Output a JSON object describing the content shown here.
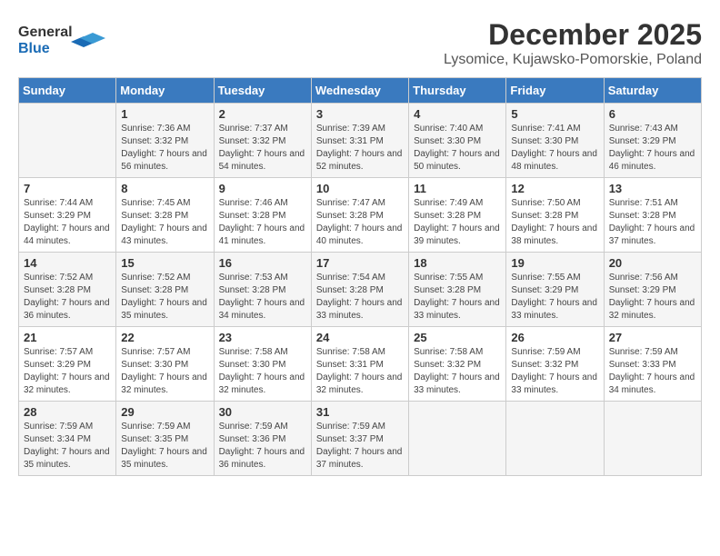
{
  "logo": {
    "line1": "General",
    "line2": "Blue"
  },
  "title": "December 2025",
  "subtitle": "Lysomice, Kujawsko-Pomorskie, Poland",
  "days_of_week": [
    "Sunday",
    "Monday",
    "Tuesday",
    "Wednesday",
    "Thursday",
    "Friday",
    "Saturday"
  ],
  "weeks": [
    [
      {
        "day": "",
        "info": ""
      },
      {
        "day": "1",
        "info": "Sunrise: 7:36 AM\nSunset: 3:32 PM\nDaylight: 7 hours\nand 56 minutes."
      },
      {
        "day": "2",
        "info": "Sunrise: 7:37 AM\nSunset: 3:32 PM\nDaylight: 7 hours\nand 54 minutes."
      },
      {
        "day": "3",
        "info": "Sunrise: 7:39 AM\nSunset: 3:31 PM\nDaylight: 7 hours\nand 52 minutes."
      },
      {
        "day": "4",
        "info": "Sunrise: 7:40 AM\nSunset: 3:30 PM\nDaylight: 7 hours\nand 50 minutes."
      },
      {
        "day": "5",
        "info": "Sunrise: 7:41 AM\nSunset: 3:30 PM\nDaylight: 7 hours\nand 48 minutes."
      },
      {
        "day": "6",
        "info": "Sunrise: 7:43 AM\nSunset: 3:29 PM\nDaylight: 7 hours\nand 46 minutes."
      }
    ],
    [
      {
        "day": "7",
        "info": "Sunrise: 7:44 AM\nSunset: 3:29 PM\nDaylight: 7 hours\nand 44 minutes."
      },
      {
        "day": "8",
        "info": "Sunrise: 7:45 AM\nSunset: 3:28 PM\nDaylight: 7 hours\nand 43 minutes."
      },
      {
        "day": "9",
        "info": "Sunrise: 7:46 AM\nSunset: 3:28 PM\nDaylight: 7 hours\nand 41 minutes."
      },
      {
        "day": "10",
        "info": "Sunrise: 7:47 AM\nSunset: 3:28 PM\nDaylight: 7 hours\nand 40 minutes."
      },
      {
        "day": "11",
        "info": "Sunrise: 7:49 AM\nSunset: 3:28 PM\nDaylight: 7 hours\nand 39 minutes."
      },
      {
        "day": "12",
        "info": "Sunrise: 7:50 AM\nSunset: 3:28 PM\nDaylight: 7 hours\nand 38 minutes."
      },
      {
        "day": "13",
        "info": "Sunrise: 7:51 AM\nSunset: 3:28 PM\nDaylight: 7 hours\nand 37 minutes."
      }
    ],
    [
      {
        "day": "14",
        "info": "Sunrise: 7:52 AM\nSunset: 3:28 PM\nDaylight: 7 hours\nand 36 minutes."
      },
      {
        "day": "15",
        "info": "Sunrise: 7:52 AM\nSunset: 3:28 PM\nDaylight: 7 hours\nand 35 minutes."
      },
      {
        "day": "16",
        "info": "Sunrise: 7:53 AM\nSunset: 3:28 PM\nDaylight: 7 hours\nand 34 minutes."
      },
      {
        "day": "17",
        "info": "Sunrise: 7:54 AM\nSunset: 3:28 PM\nDaylight: 7 hours\nand 33 minutes."
      },
      {
        "day": "18",
        "info": "Sunrise: 7:55 AM\nSunset: 3:28 PM\nDaylight: 7 hours\nand 33 minutes."
      },
      {
        "day": "19",
        "info": "Sunrise: 7:55 AM\nSunset: 3:29 PM\nDaylight: 7 hours\nand 33 minutes."
      },
      {
        "day": "20",
        "info": "Sunrise: 7:56 AM\nSunset: 3:29 PM\nDaylight: 7 hours\nand 32 minutes."
      }
    ],
    [
      {
        "day": "21",
        "info": "Sunrise: 7:57 AM\nSunset: 3:29 PM\nDaylight: 7 hours\nand 32 minutes."
      },
      {
        "day": "22",
        "info": "Sunrise: 7:57 AM\nSunset: 3:30 PM\nDaylight: 7 hours\nand 32 minutes."
      },
      {
        "day": "23",
        "info": "Sunrise: 7:58 AM\nSunset: 3:30 PM\nDaylight: 7 hours\nand 32 minutes."
      },
      {
        "day": "24",
        "info": "Sunrise: 7:58 AM\nSunset: 3:31 PM\nDaylight: 7 hours\nand 32 minutes."
      },
      {
        "day": "25",
        "info": "Sunrise: 7:58 AM\nSunset: 3:32 PM\nDaylight: 7 hours\nand 33 minutes."
      },
      {
        "day": "26",
        "info": "Sunrise: 7:59 AM\nSunset: 3:32 PM\nDaylight: 7 hours\nand 33 minutes."
      },
      {
        "day": "27",
        "info": "Sunrise: 7:59 AM\nSunset: 3:33 PM\nDaylight: 7 hours\nand 34 minutes."
      }
    ],
    [
      {
        "day": "28",
        "info": "Sunrise: 7:59 AM\nSunset: 3:34 PM\nDaylight: 7 hours\nand 35 minutes."
      },
      {
        "day": "29",
        "info": "Sunrise: 7:59 AM\nSunset: 3:35 PM\nDaylight: 7 hours\nand 35 minutes."
      },
      {
        "day": "30",
        "info": "Sunrise: 7:59 AM\nSunset: 3:36 PM\nDaylight: 7 hours\nand 36 minutes."
      },
      {
        "day": "31",
        "info": "Sunrise: 7:59 AM\nSunset: 3:37 PM\nDaylight: 7 hours\nand 37 minutes."
      },
      {
        "day": "",
        "info": ""
      },
      {
        "day": "",
        "info": ""
      },
      {
        "day": "",
        "info": ""
      }
    ]
  ]
}
